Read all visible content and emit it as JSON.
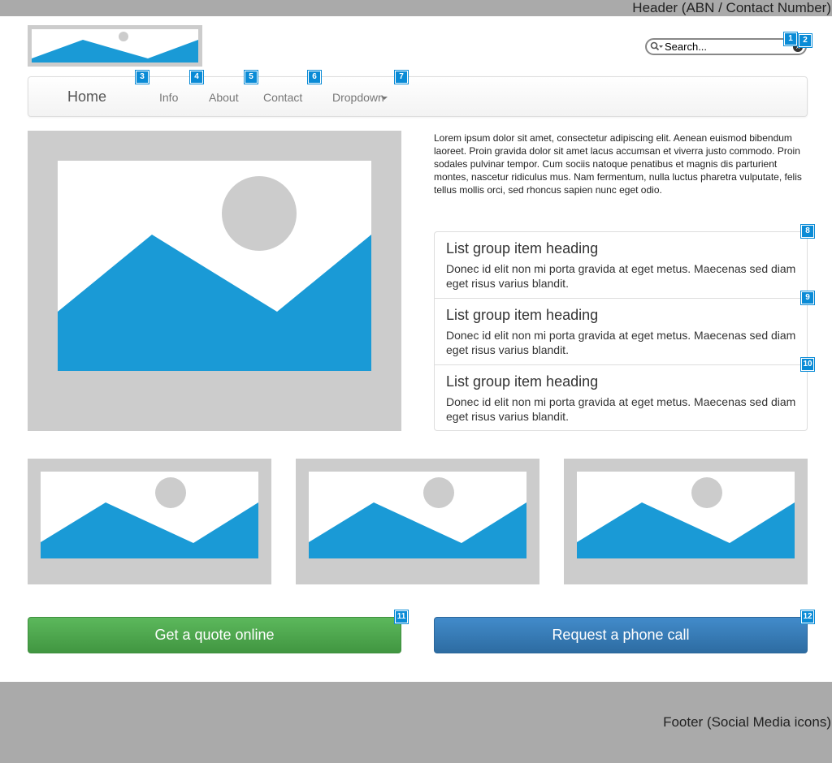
{
  "header": {
    "text": "Header (ABN / Contact Number)"
  },
  "search": {
    "placeholder": "Search..."
  },
  "nav": {
    "brand": "Home",
    "links": [
      "Info",
      "About",
      "Contact",
      "Dropdown"
    ]
  },
  "intro": {
    "text": "Lorem ipsum dolor sit amet, consectetur adipiscing elit. Aenean euismod bibendum laoreet. Proin gravida dolor sit amet lacus accumsan et viverra justo commodo. Proin sodales pulvinar tempor. Cum sociis natoque penatibus et magnis dis parturient montes, nascetur ridiculus mus. Nam fermentum, nulla luctus pharetra vulputate, felis tellus mollis orci, sed rhoncus sapien nunc eget odio."
  },
  "list_group": [
    {
      "heading": "List group item heading",
      "text": "Donec id elit non mi porta gravida at eget metus. Maecenas sed diam eget risus varius blandit."
    },
    {
      "heading": "List group item heading",
      "text": "Donec id elit non mi porta gravida at eget metus. Maecenas sed diam eget risus varius blandit."
    },
    {
      "heading": "List group item heading",
      "text": "Donec id elit non mi porta gravida at eget metus. Maecenas sed diam eget risus varius blandit."
    }
  ],
  "buttons": {
    "quote": "Get a quote online",
    "phone": "Request a phone call"
  },
  "markers": [
    "1",
    "2",
    "3",
    "4",
    "5",
    "6",
    "7",
    "8",
    "9",
    "10",
    "11",
    "12"
  ],
  "footer": {
    "text": "Footer (Social Media icons)"
  },
  "colors": {
    "placeholder_gray": "#cccccc",
    "image_blue": "#1a9ad6",
    "marker_blue": "#0a8bd6",
    "button_green": "#4cae4c",
    "button_blue": "#337ab7",
    "band_gray": "#aaaaaa"
  },
  "icons": {
    "search": "search-icon",
    "clear": "clear-icon",
    "dropdown": "caret-down-icon",
    "image_placeholder": "image-placeholder-icon"
  }
}
